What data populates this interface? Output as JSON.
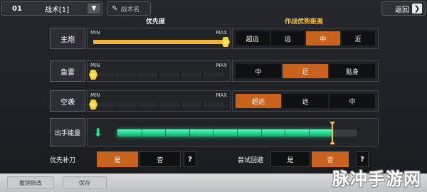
{
  "topbar": {
    "tactic_number": "01",
    "tactic_label": "战术[1]",
    "tactic_name_placeholder": "战术名",
    "back_label": "返回"
  },
  "column_headers": {
    "priority": "优先度",
    "distance": "作战优势距离"
  },
  "slider_labels": {
    "min": "MIN",
    "max": "MAX"
  },
  "rows": [
    {
      "label": "主炮",
      "priority_level": 1.0,
      "options": [
        "超远",
        "远",
        "中",
        "近"
      ],
      "selected": 2
    },
    {
      "label": "鱼雷",
      "priority_level": 0.0,
      "options": [
        "中",
        "近",
        "贴身"
      ],
      "selected": 1
    },
    {
      "label": "空袭",
      "priority_level": 0.0,
      "options": [
        "超远",
        "远",
        "中"
      ],
      "selected": 0
    }
  ],
  "energy": {
    "label": "出手能量",
    "level": 0.9
  },
  "toggles": {
    "fill_blade": {
      "label": "优先补刀",
      "yes": "是",
      "no": "否",
      "selected": "yes",
      "help": "?"
    },
    "evade": {
      "label": "尝试回避",
      "yes": "是",
      "no": "否",
      "selected": "no",
      "help": "?"
    }
  },
  "bottombar": {
    "undo_label": "撤销修改",
    "save_label": "保存"
  },
  "watermark": "脉冲手游网",
  "colors": {
    "accent_orange": "#c8621d",
    "slider_yellow": "#f0b43a",
    "energy_green": "#21d98f",
    "header_gold": "#f6c242"
  }
}
